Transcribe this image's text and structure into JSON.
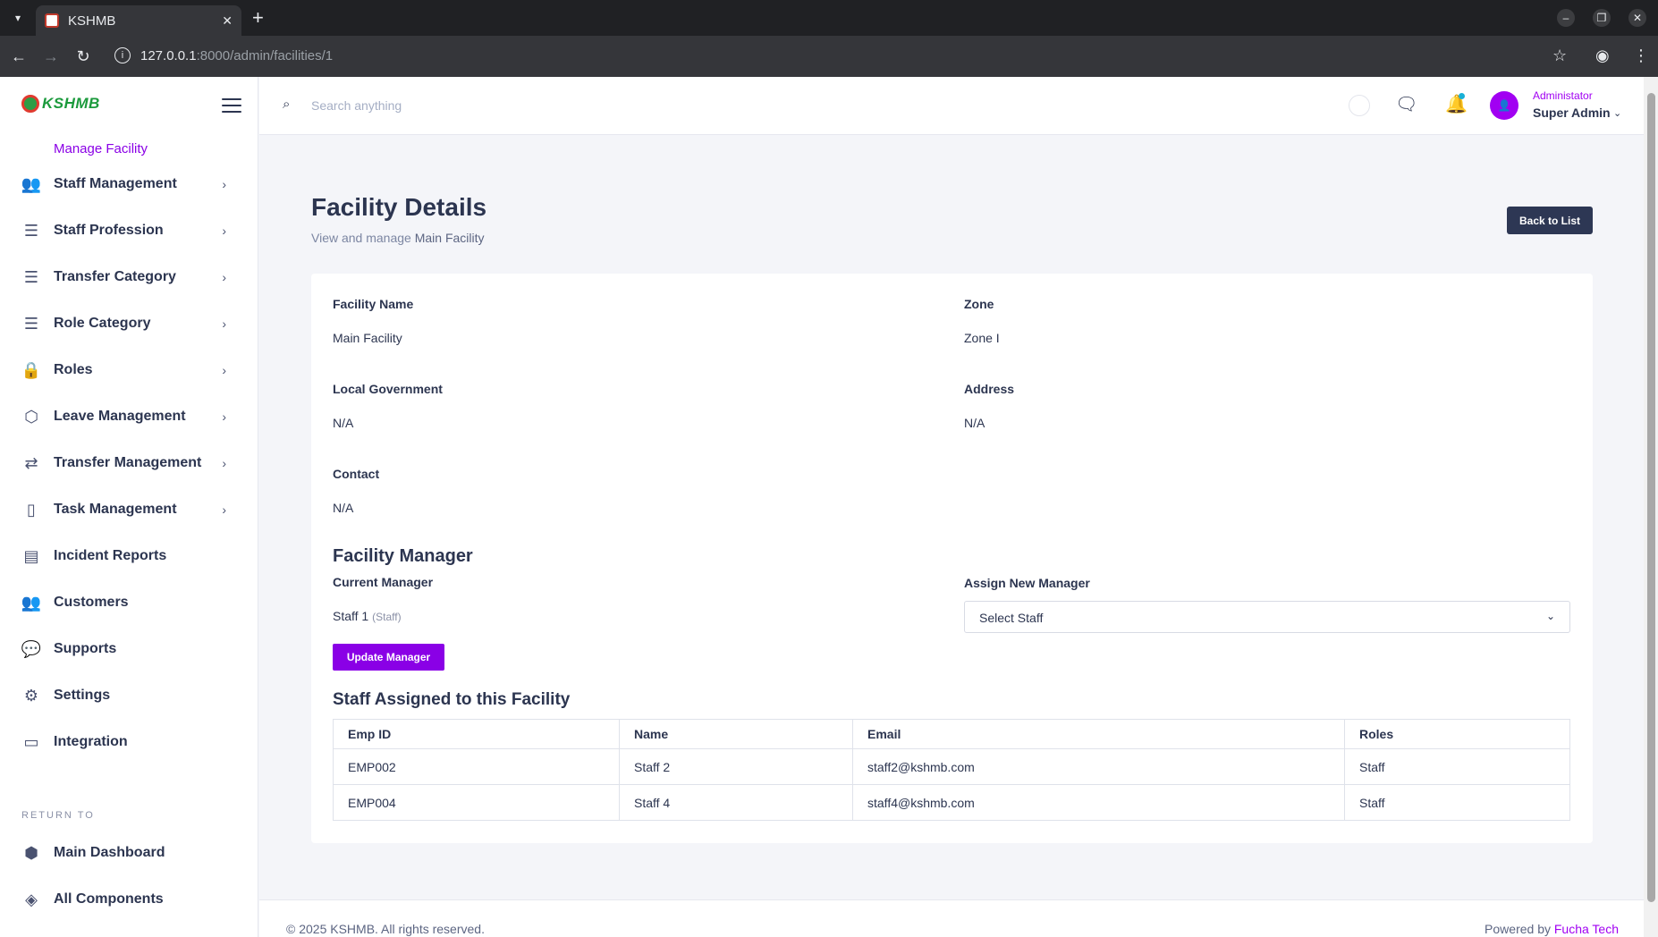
{
  "browser": {
    "tab_title": "KSHMB",
    "url_host": "127.0.0.1",
    "url_path": ":8000/admin/facilities/1"
  },
  "sidebar": {
    "logo_text": "KSHMB",
    "active_item": "Manage Facility",
    "items": [
      {
        "label": "Staff Management",
        "icon": "users-icon",
        "has_submenu": true
      },
      {
        "label": "Staff Profession",
        "icon": "lines-icon",
        "has_submenu": true
      },
      {
        "label": "Transfer Category",
        "icon": "lines-icon",
        "has_submenu": true
      },
      {
        "label": "Role Category",
        "icon": "lines-icon",
        "has_submenu": true
      },
      {
        "label": "Roles",
        "icon": "lock-icon",
        "has_submenu": true
      },
      {
        "label": "Leave Management",
        "icon": "box-icon",
        "has_submenu": true
      },
      {
        "label": "Transfer Management",
        "icon": "arrows-icon",
        "has_submenu": true
      },
      {
        "label": "Task Management",
        "icon": "clipboard-icon",
        "has_submenu": true
      },
      {
        "label": "Incident Reports",
        "icon": "list-icon",
        "has_submenu": false
      },
      {
        "label": "Customers",
        "icon": "customers-icon",
        "has_submenu": false
      },
      {
        "label": "Supports",
        "icon": "chat-icon",
        "has_submenu": false
      },
      {
        "label": "Settings",
        "icon": "settings-icon",
        "has_submenu": false
      },
      {
        "label": "Integration",
        "icon": "server-icon",
        "has_submenu": false
      }
    ],
    "return_to_label": "RETURN TO",
    "return_items": [
      {
        "label": "Main Dashboard",
        "icon": "shield-icon"
      },
      {
        "label": "All Components",
        "icon": "layers-icon"
      }
    ]
  },
  "header": {
    "search_placeholder": "Search anything",
    "user_role": "Administator",
    "user_name": "Super Admin"
  },
  "page": {
    "title": "Facility Details",
    "subtitle_prefix": "View and manage",
    "subtitle_name": "Main Facility",
    "back_button": "Back to List"
  },
  "details": {
    "facility_name_label": "Facility Name",
    "facility_name": "Main Facility",
    "zone_label": "Zone",
    "zone": "Zone I",
    "local_gov_label": "Local Government",
    "local_gov": "N/A",
    "address_label": "Address",
    "address": "N/A",
    "contact_label": "Contact",
    "contact": "N/A"
  },
  "manager": {
    "section_title": "Facility Manager",
    "current_label": "Current Manager",
    "current_name": "Staff 1",
    "current_role": "(Staff)",
    "assign_label": "Assign New Manager",
    "select_value": "Select Staff",
    "update_button": "Update Manager"
  },
  "staff": {
    "section_title": "Staff Assigned to this Facility",
    "columns": [
      "Emp ID",
      "Name",
      "Email",
      "Roles"
    ],
    "rows": [
      [
        "EMP002",
        "Staff 2",
        "staff2@kshmb.com",
        "Staff"
      ],
      [
        "EMP004",
        "Staff 4",
        "staff4@kshmb.com",
        "Staff"
      ]
    ]
  },
  "footer": {
    "copyright": "© 2025 KSHMB. All rights reserved.",
    "powered_prefix": "Powered by",
    "powered_name": "Fucha Tech"
  },
  "colors": {
    "accent": "#8a00e6",
    "dark_button": "#2d3754",
    "text": "#2c3550"
  }
}
